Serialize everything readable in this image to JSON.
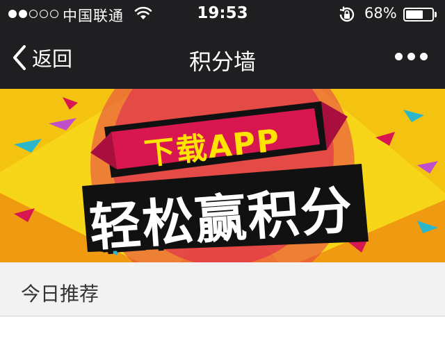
{
  "status_bar": {
    "carrier": "中国联通",
    "time": "19:53",
    "battery_percent": "68%",
    "battery_level": 0.68,
    "signal_bars_filled": 2,
    "signal_bars_total": 5
  },
  "nav": {
    "back_label": "返回",
    "title": "积分墙"
  },
  "banner": {
    "line1": "下载APP",
    "line2": "轻松赢积分"
  },
  "section": {
    "title": "今日推荐"
  },
  "colors": {
    "bar_bg": "#1f1f22",
    "banner_yellow": "#f7d61a",
    "banner_red": "#d8164f",
    "section_bg": "#f2f2f2"
  },
  "icons": [
    "chevron-left-icon",
    "more-dots-icon",
    "wifi-icon",
    "orientation-lock-icon",
    "battery-icon"
  ]
}
